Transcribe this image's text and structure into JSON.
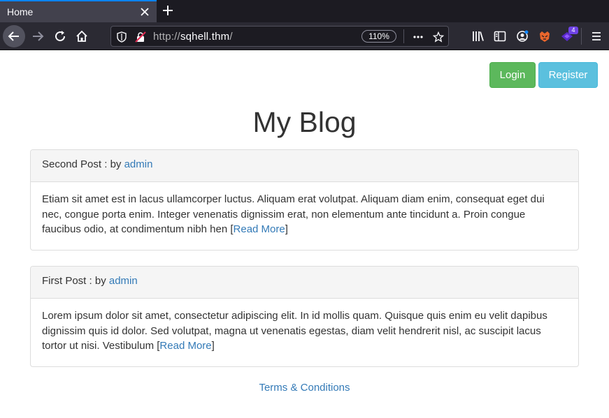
{
  "browser": {
    "tab_title": "Home",
    "url_scheme": "http://",
    "url_host": "sqhell.thm",
    "url_path": "/",
    "zoom": "110%",
    "extension_badge": "4"
  },
  "header": {
    "login_label": "Login",
    "register_label": "Register"
  },
  "page": {
    "title": "My Blog"
  },
  "posts": [
    {
      "title": "Second Post",
      "by_prefix": " : by ",
      "author": "admin",
      "excerpt": "Etiam sit amet est in lacus ullamcorper luctus. Aliquam erat volutpat. Aliquam diam enim, consequat eget dui nec, congue porta enim. Integer venenatis dignissim erat, non elementum ante tincidunt a. Proin congue faucibus odio, at condimentum nibh hen ",
      "read_more": "Read More"
    },
    {
      "title": "First Post",
      "by_prefix": " : by ",
      "author": "admin",
      "excerpt": "Lorem ipsum dolor sit amet, consectetur adipiscing elit. In id mollis quam. Quisque quis enim eu velit dapibus dignissim quis id dolor. Sed volutpat, magna ut venenatis egestas, diam velit hendrerit nisl, ac suscipit lacus tortor ut nisi. Vestibulum ",
      "read_more": "Read More"
    }
  ],
  "footer": {
    "terms_label": "Terms & Conditions"
  },
  "icons": {
    "back": "back-arrow-icon",
    "forward": "forward-arrow-icon",
    "reload": "reload-icon",
    "home": "home-icon",
    "shield": "shield-icon",
    "insecure": "insecure-lock-icon",
    "more": "more-dots-icon",
    "bookmark": "star-icon",
    "library": "library-icon",
    "sidebar": "sidebar-icon",
    "account": "account-icon",
    "extension_fox": "extension-fox-icon",
    "extension_purple": "extension-purple-icon",
    "menu": "hamburger-menu-icon"
  },
  "colors": {
    "success": "#5cb85c",
    "info": "#5bc0de",
    "link": "#337ab7",
    "tab_accent": "#0a84ff"
  }
}
